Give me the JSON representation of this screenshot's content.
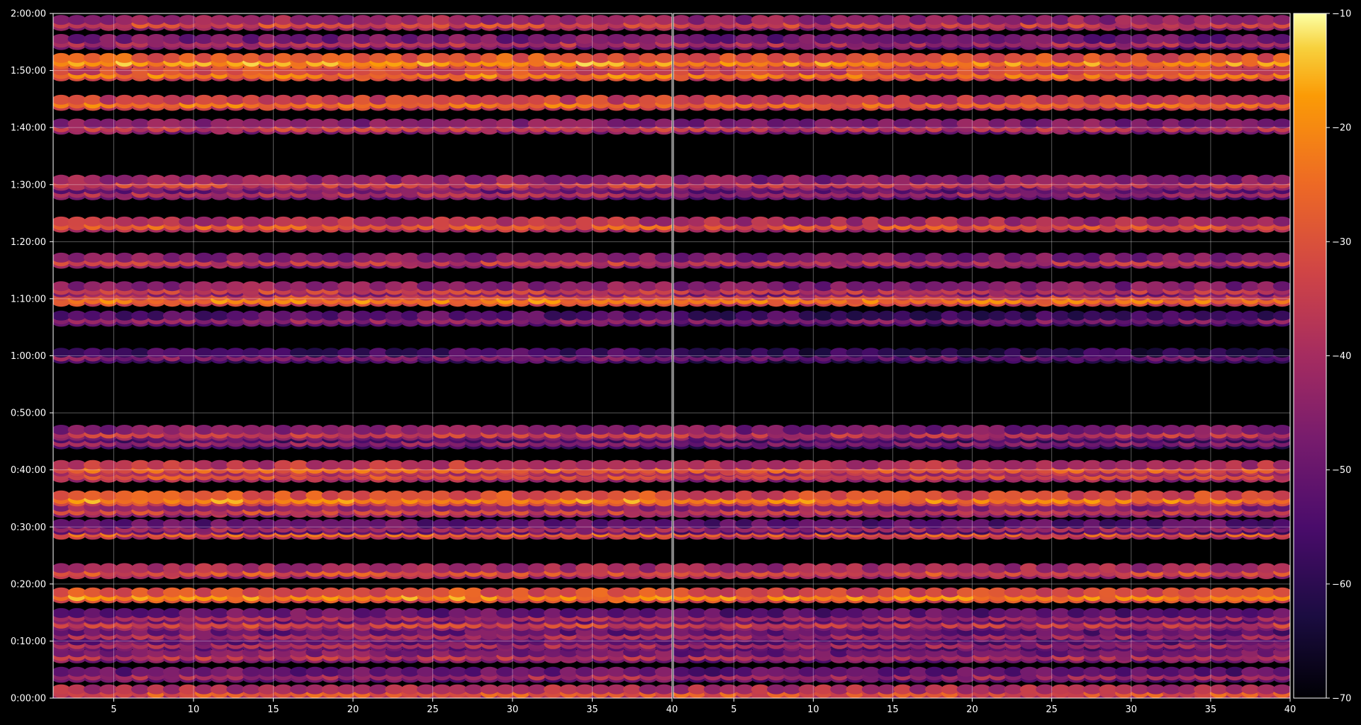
{
  "chart_data": {
    "type": "heatmap",
    "title": "",
    "xlabel": "",
    "ylabel": "",
    "grid": true,
    "colormap": "inferno",
    "panels": [
      {
        "name": "",
        "xlim": [
          1.2,
          40
        ],
        "xticks": [
          5,
          10,
          15,
          20,
          25,
          30,
          35,
          40
        ],
        "x_cells": 39,
        "rows_seconds": [
          60,
          245,
          450,
          575,
          670,
          790,
          862,
          1080,
          1335,
          1750,
          1800,
          1980,
          2100,
          2350,
          2420,
          2700,
          2790,
          3600,
          3990,
          4200,
          4300,
          4600,
          4980,
          5320,
          5420,
          6010,
          6260,
          6570,
          6700,
          6900,
          7100
        ],
        "row_base_values": [
          -29,
          -40,
          -37,
          -40,
          -40,
          -33,
          -40,
          -20,
          -30,
          -27,
          -41,
          -33,
          -20,
          -31,
          -27,
          -44,
          -35,
          -46,
          -43,
          -22,
          -34,
          -35,
          -28,
          -39,
          -33,
          -35,
          -24,
          -22,
          -18,
          -38,
          -32
        ]
      },
      {
        "name": "",
        "xlim": [
          1.2,
          40
        ],
        "xticks": [
          5,
          10,
          15,
          20,
          25,
          30,
          35,
          40
        ],
        "x_cells": 39,
        "rows_seconds": [
          60,
          245,
          450,
          575,
          670,
          790,
          862,
          1080,
          1335,
          1750,
          1800,
          1980,
          2100,
          2350,
          2420,
          2700,
          2790,
          3600,
          3990,
          4200,
          4300,
          4600,
          4980,
          5320,
          5420,
          6010,
          6260,
          6570,
          6700,
          6900,
          7100
        ],
        "row_base_values": [
          -29,
          -42,
          -39,
          -42,
          -42,
          -35,
          -42,
          -22,
          -31,
          -29,
          -43,
          -35,
          -22,
          -33,
          -29,
          -46,
          -37,
          -50,
          -47,
          -24,
          -37,
          -37,
          -30,
          -42,
          -36,
          -37,
          -26,
          -24,
          -20,
          -40,
          -34
        ]
      }
    ],
    "ylim_seconds": [
      0,
      7200
    ],
    "yticks": [
      "0:00:00",
      "0:10:00",
      "0:20:00",
      "0:30:00",
      "0:40:00",
      "0:50:00",
      "1:00:00",
      "1:10:00",
      "1:20:00",
      "1:30:00",
      "1:40:00",
      "1:50:00",
      "2:00:00"
    ],
    "colorbar": {
      "range": [
        -70,
        -10
      ],
      "ticks": [
        "-10",
        "-20",
        "-30",
        "-40",
        "-50",
        "-60",
        "-70"
      ]
    }
  }
}
